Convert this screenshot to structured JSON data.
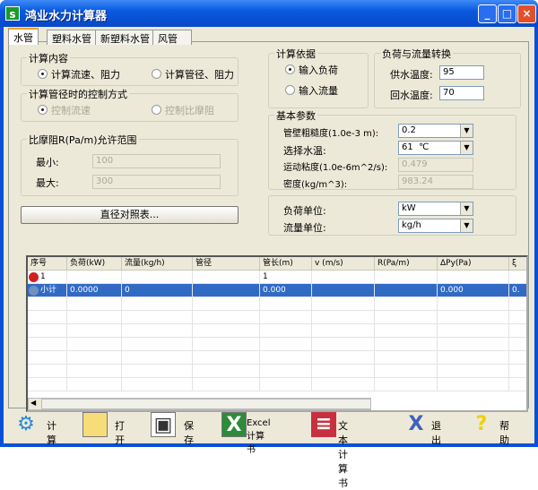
{
  "window": {
    "title": "鸿业水力计算器",
    "icon": "s"
  },
  "tabs": [
    "水管",
    "塑料水管",
    "新塑料水管",
    "风管"
  ],
  "calc_content": {
    "legend": "计算内容",
    "options": [
      "计算流速、阻力",
      "计算管径、阻力"
    ],
    "selected": 0
  },
  "control": {
    "legend": "计算管径时的控制方式",
    "options": [
      "控制流速",
      "控制比摩阻"
    ],
    "selected": 0
  },
  "range": {
    "legend": "比摩阻R(Pa/m)允许范围",
    "min_label": "最小:",
    "min_value": "100",
    "max_label": "最大:",
    "max_value": "300"
  },
  "diameter_button": "直径对照表...",
  "basis": {
    "legend": "计算依据",
    "options": [
      "输入负荷",
      "输入流量"
    ],
    "selected": 0
  },
  "conversion": {
    "legend": "负荷与流量转换",
    "supply_label": "供水温度:",
    "supply_value": "95",
    "return_label": "回水温度:",
    "return_value": "70"
  },
  "params": {
    "legend": "基本参数",
    "roughness_label": "管壁粗糙度(1.0e-3 m):",
    "roughness_value": "0.2",
    "temp_label": "选择水温:",
    "temp_value": "61  ℃",
    "viscosity_label": "运动粘度(1.0e-6m^2/s):",
    "viscosity_value": "0.479",
    "density_label": "密度(kg/m^3):",
    "density_value": "983.24"
  },
  "units": {
    "load_label": "负荷单位:",
    "load_value": "kW",
    "flow_label": "流量单位:",
    "flow_value": "kg/h"
  },
  "table": {
    "headers": [
      "序号",
      "负荷(kW)",
      "流量(kg/h)",
      "管径",
      "管长(m)",
      "v (m/s)",
      "R(Pa/m)",
      "ΔPy(Pa)",
      "ξ"
    ],
    "rows": [
      [
        "1",
        "",
        "",
        "",
        "1",
        "",
        "",
        "",
        ""
      ],
      [
        "小计",
        "0.0000",
        "0",
        "",
        "0.000",
        "",
        "",
        "0.000",
        "0."
      ]
    ]
  },
  "toolbar": [
    "计算",
    "打开",
    "保存",
    "Excel计算书",
    "文本计算书",
    "退出",
    "帮助"
  ]
}
